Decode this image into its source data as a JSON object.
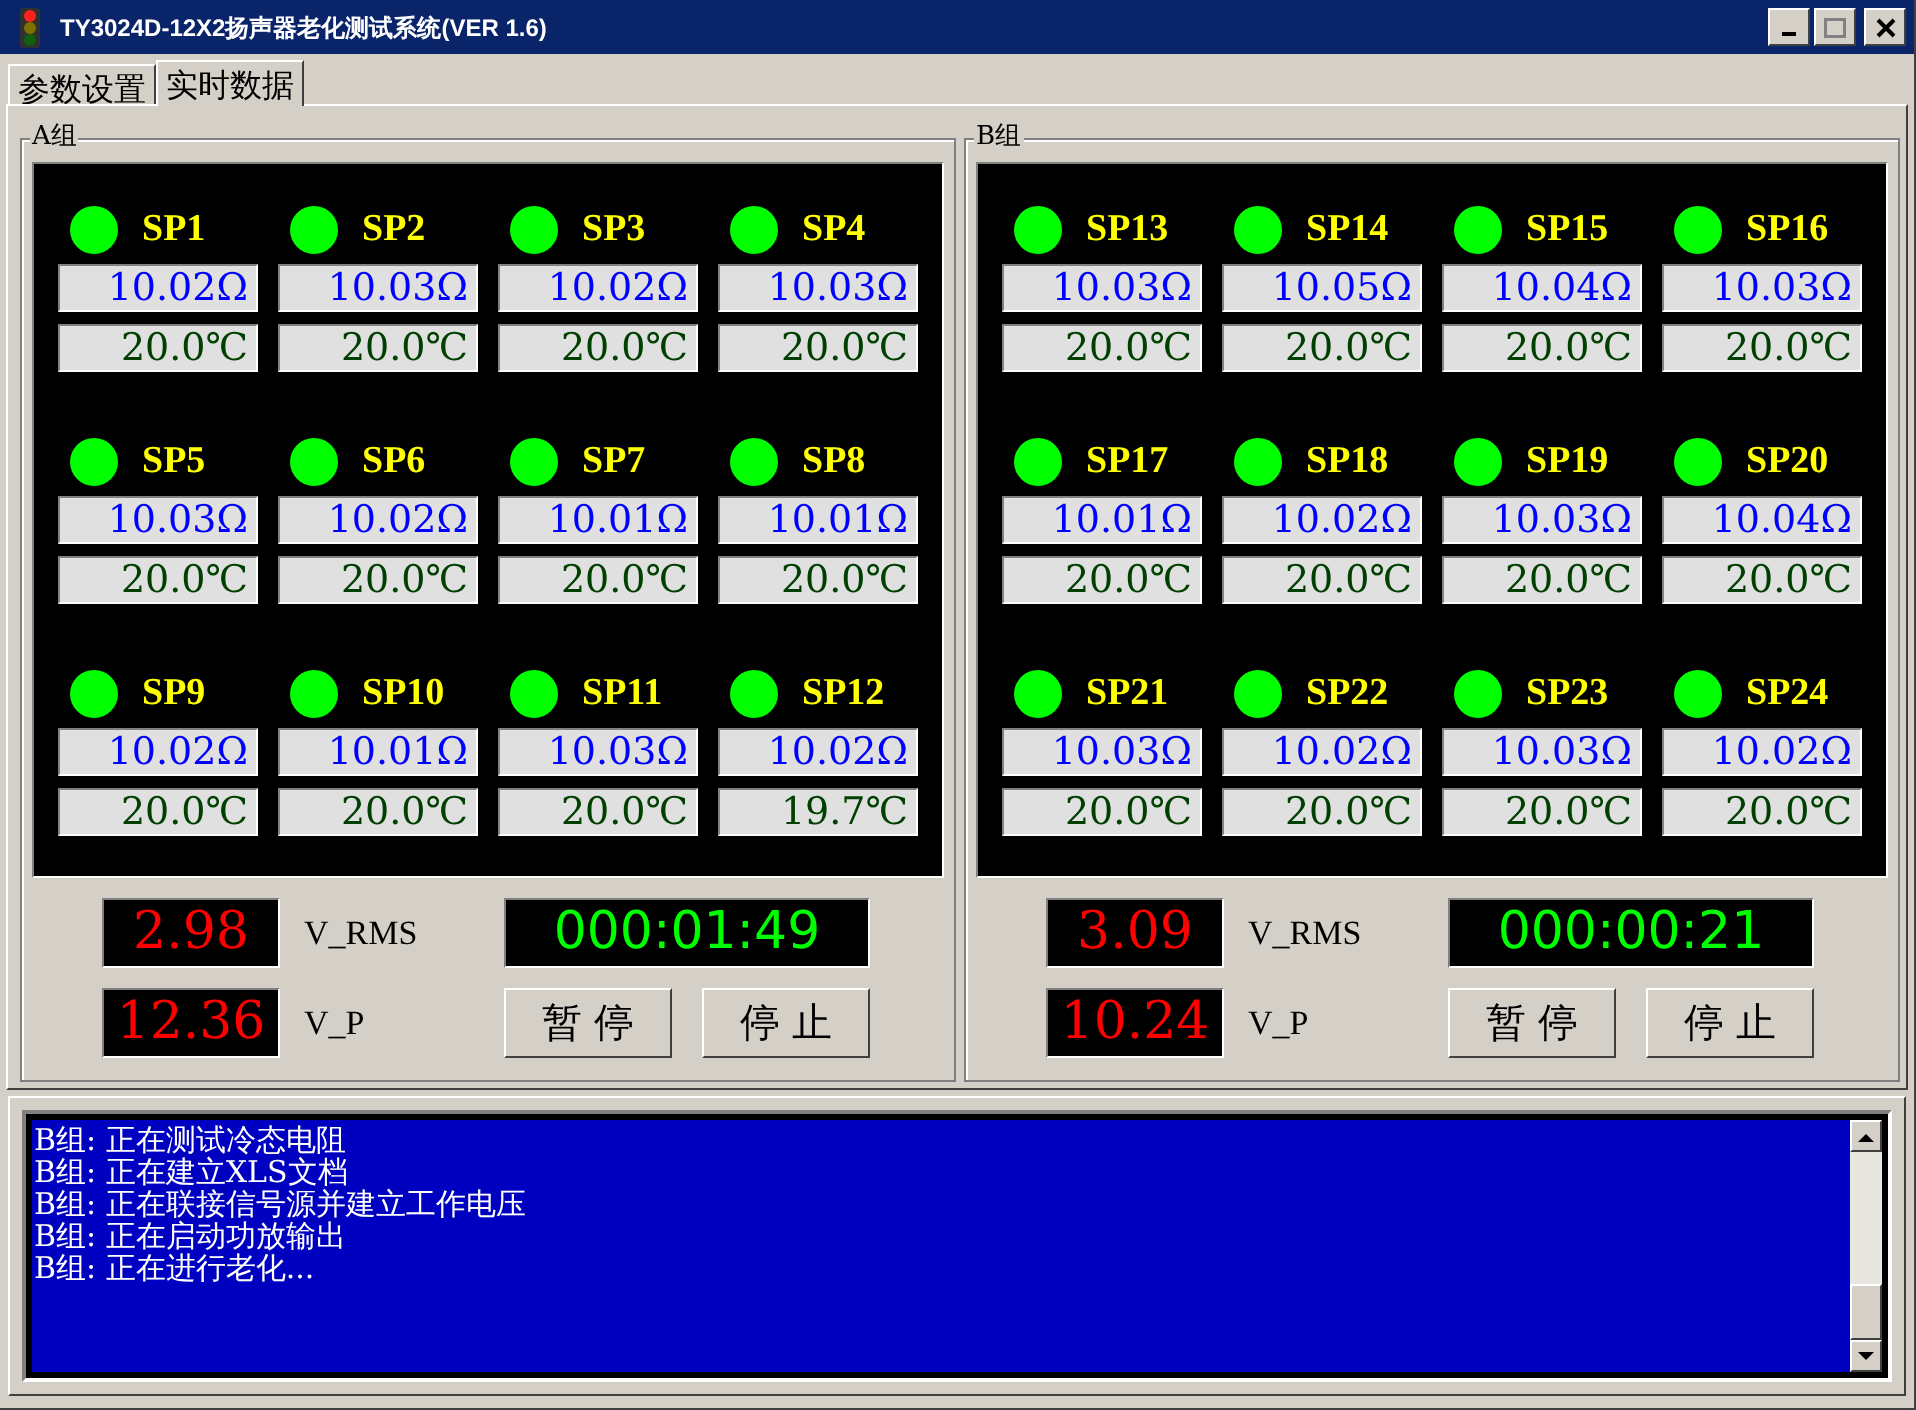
{
  "window": {
    "title": "TY3024D-12X2扬声器老化测试系统(VER 1.6)"
  },
  "tabs": [
    {
      "label": "参数设置",
      "selected": false
    },
    {
      "label": "实时数据",
      "selected": true
    }
  ],
  "groups": [
    {
      "title": "A组",
      "speakers": [
        {
          "name": "SP1",
          "on": true,
          "resistance": "10.02Ω",
          "temperature": "20.0℃"
        },
        {
          "name": "SP2",
          "on": true,
          "resistance": "10.03Ω",
          "temperature": "20.0℃"
        },
        {
          "name": "SP3",
          "on": true,
          "resistance": "10.02Ω",
          "temperature": "20.0℃"
        },
        {
          "name": "SP4",
          "on": true,
          "resistance": "10.03Ω",
          "temperature": "20.0℃"
        },
        {
          "name": "SP5",
          "on": true,
          "resistance": "10.03Ω",
          "temperature": "20.0℃"
        },
        {
          "name": "SP6",
          "on": true,
          "resistance": "10.02Ω",
          "temperature": "20.0℃"
        },
        {
          "name": "SP7",
          "on": true,
          "resistance": "10.01Ω",
          "temperature": "20.0℃"
        },
        {
          "name": "SP8",
          "on": true,
          "resistance": "10.01Ω",
          "temperature": "20.0℃"
        },
        {
          "name": "SP9",
          "on": true,
          "resistance": "10.02Ω",
          "temperature": "20.0℃"
        },
        {
          "name": "SP10",
          "on": true,
          "resistance": "10.01Ω",
          "temperature": "20.0℃"
        },
        {
          "name": "SP11",
          "on": true,
          "resistance": "10.03Ω",
          "temperature": "20.0℃"
        },
        {
          "name": "SP12",
          "on": true,
          "resistance": "10.02Ω",
          "temperature": "19.7℃"
        }
      ],
      "v_rms": "2.98",
      "v_rms_label": "V_RMS",
      "v_p": "12.36",
      "v_p_label": "V_P",
      "timer": "000:01:49",
      "buttons": [
        "暂 停",
        "停 止"
      ]
    },
    {
      "title": "B组",
      "speakers": [
        {
          "name": "SP13",
          "on": true,
          "resistance": "10.03Ω",
          "temperature": "20.0℃"
        },
        {
          "name": "SP14",
          "on": true,
          "resistance": "10.05Ω",
          "temperature": "20.0℃"
        },
        {
          "name": "SP15",
          "on": true,
          "resistance": "10.04Ω",
          "temperature": "20.0℃"
        },
        {
          "name": "SP16",
          "on": true,
          "resistance": "10.03Ω",
          "temperature": "20.0℃"
        },
        {
          "name": "SP17",
          "on": true,
          "resistance": "10.01Ω",
          "temperature": "20.0℃"
        },
        {
          "name": "SP18",
          "on": true,
          "resistance": "10.02Ω",
          "temperature": "20.0℃"
        },
        {
          "name": "SP19",
          "on": true,
          "resistance": "10.03Ω",
          "temperature": "20.0℃"
        },
        {
          "name": "SP20",
          "on": true,
          "resistance": "10.04Ω",
          "temperature": "20.0℃"
        },
        {
          "name": "SP21",
          "on": true,
          "resistance": "10.03Ω",
          "temperature": "20.0℃"
        },
        {
          "name": "SP22",
          "on": true,
          "resistance": "10.02Ω",
          "temperature": "20.0℃"
        },
        {
          "name": "SP23",
          "on": true,
          "resistance": "10.03Ω",
          "temperature": "20.0℃"
        },
        {
          "name": "SP24",
          "on": true,
          "resistance": "10.02Ω",
          "temperature": "20.0℃"
        }
      ],
      "v_rms": "3.09",
      "v_rms_label": "V_RMS",
      "v_p": "10.24",
      "v_p_label": "V_P",
      "timer": "000:00:21",
      "buttons": [
        "暂 停",
        "停 止"
      ]
    }
  ],
  "log": [
    "B组: 正在测试冷态电阻",
    "B组: 正在建立XLS文档",
    "B组: 正在联接信号源并建立工作电压",
    "B组: 正在启动功放输出",
    "B组: 正在进行老化..."
  ]
}
